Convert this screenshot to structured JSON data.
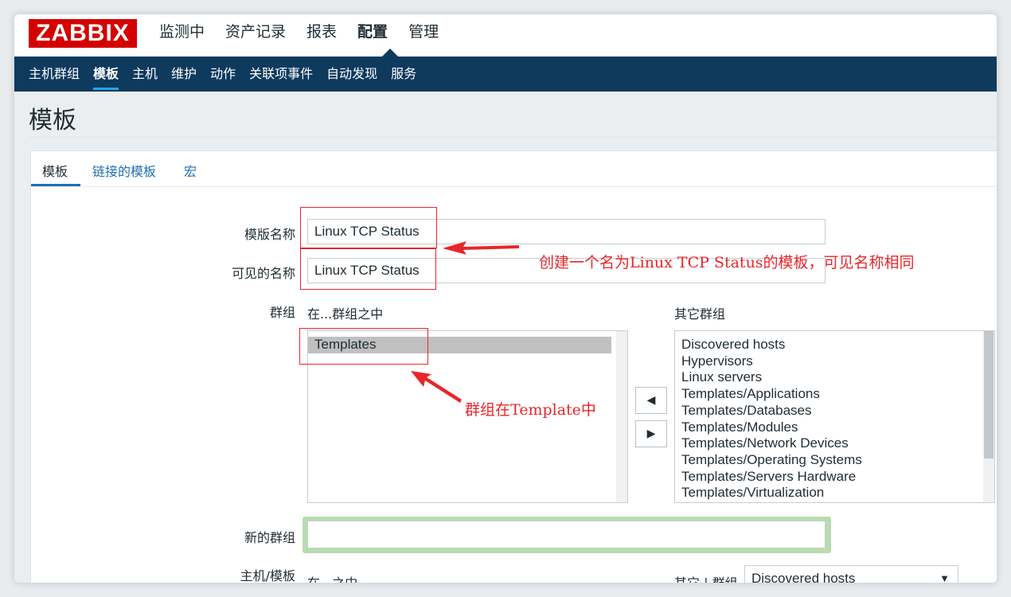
{
  "logo": "ZABBIX",
  "topmenu": [
    "监测中",
    "资产记录",
    "报表",
    "配置",
    "管理"
  ],
  "submenu": [
    "主机群组",
    "模板",
    "主机",
    "维护",
    "动作",
    "关联项事件",
    "自动发现",
    "服务"
  ],
  "page_title": "模板",
  "tabs": [
    "模板",
    "链接的模板",
    "宏"
  ],
  "form": {
    "template_name_label": "模版名称",
    "template_name_value": "Linux TCP Status",
    "visible_name_label": "可见的名称",
    "visible_name_value": "Linux TCP Status",
    "groups_label": "群组",
    "in_groups_label": "在...群组之中",
    "other_groups_label": "其它群组",
    "in_groups": [
      "Templates"
    ],
    "other_groups": [
      "Discovered hosts",
      "Hypervisors",
      "Linux servers",
      "Templates/Applications",
      "Templates/Databases",
      "Templates/Modules",
      "Templates/Network Devices",
      "Templates/Operating Systems",
      "Templates/Servers Hardware",
      "Templates/Virtualization"
    ],
    "new_group_label": "新的群组",
    "new_group_value": "",
    "hosts_templates_label": "主机/模板",
    "in_label": "在...之中",
    "other_group_label": "其它 | 群组",
    "group_select_value": "Discovered hosts"
  },
  "annotations": {
    "name_note": "创建一个名为Linux TCP Status的模板，可见名称相同",
    "group_note": "群组在Template中"
  },
  "colors": {
    "brand": "#d40000",
    "subnav": "#0e3a5e",
    "link": "#1f6fb2",
    "annotation": "#e8262a"
  }
}
